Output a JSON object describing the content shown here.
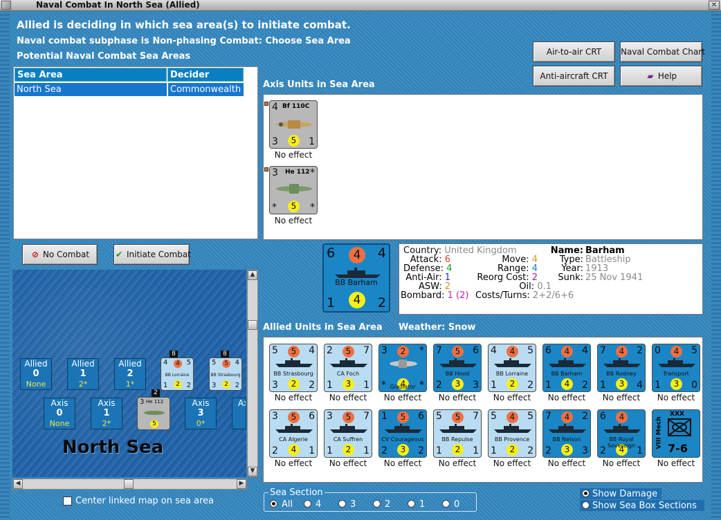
{
  "window": {
    "title": "Naval Combat In North Sea (Allied)"
  },
  "header": {
    "line1": "Allied is deciding in which sea area(s) to initiate combat.",
    "line2": "Naval combat subphase is Non-phasing Combat: Choose Sea Area",
    "line3": "Potential Naval Combat Sea Areas"
  },
  "sea_table": {
    "columns": [
      "Sea Area",
      "Decider"
    ],
    "rows": [
      [
        "North Sea",
        "Commonwealth"
      ]
    ]
  },
  "buttons": {
    "air_to_air": "Air-to-air CRT",
    "naval_chart": "Naval Combat Chart",
    "anti_aircraft": "Anti-aircraft CRT",
    "help": "Help",
    "no_combat": "No Combat",
    "initiate": "Initiate Combat"
  },
  "axis_section": {
    "title": "Axis Units in Sea Area",
    "units": [
      {
        "name": "Bf 110C",
        "tl": "4",
        "bl": "3",
        "br": "1",
        "mid": "5",
        "effect": "No effect"
      },
      {
        "name": "He 112",
        "tl": "3",
        "tr": "*",
        "bl": "*",
        "br": "*",
        "mid": "5",
        "effect": "No effect"
      }
    ]
  },
  "selected_unit": {
    "name": "BB Barham",
    "tl": "6",
    "attack": "4",
    "tr": "4",
    "bl": "1",
    "defense": "4",
    "br": "2"
  },
  "info": {
    "country_label": "Country:",
    "country": "United Kingdom",
    "attack_label": "Attack:",
    "attack": "6",
    "defense_label": "Defense:",
    "defense": "4",
    "antiair_label": "Anti-Air:",
    "antiair": "1",
    "asw_label": "ASW:",
    "asw": "2",
    "bombard_label": "Bombard:",
    "bombard": "1 (2)",
    "move_label": "Move:",
    "move": "4",
    "range_label": "Range:",
    "range": "4",
    "reorg_label": "Reorg Cost:",
    "reorg": "2",
    "oil_label": "Oil:",
    "oil": "0.1",
    "costs_label": "Costs/Turns:",
    "costs": "2+2/6+6",
    "name_label": "Name:",
    "name": "Barham",
    "type_label": "Type:",
    "type": "Battleship",
    "year_label": "Year:",
    "year": "1913",
    "sunk_label": "Sunk:",
    "sunk": "25 Nov 1941"
  },
  "allied_section": {
    "title": "Allied Units in Sea Area",
    "weather": "Weather:  Snow",
    "row1": [
      {
        "name": "BB Strasbourg",
        "style": "light",
        "tl": "5",
        "o": "5",
        "tr": "4",
        "bl": "3",
        "y": "2",
        "br": "2",
        "effect": "No effect"
      },
      {
        "name": "CA Foch",
        "style": "light",
        "tl": "2",
        "o": "5",
        "tr": "7",
        "bl": "1",
        "y": "3",
        "br": "1",
        "effect": "No effect"
      },
      {
        "name": "Gladiator",
        "style": "blue",
        "tl": "3",
        "o": "2",
        "tr": "*",
        "bl": "*",
        "y": "4",
        "br": "*",
        "effect": "No effect"
      },
      {
        "name": "BB Hood",
        "style": "blue",
        "tl": "7",
        "o": "5",
        "tr": "6",
        "bl": "2",
        "y": "3",
        "br": "3",
        "effect": "No effect"
      },
      {
        "name": "BB Lorraine",
        "style": "light",
        "tl": "4",
        "o": "4",
        "tr": "5",
        "bl": "1",
        "y": "2",
        "br": "2",
        "effect": "No effect"
      },
      {
        "name": "BB Barham",
        "style": "blue",
        "tl": "6",
        "o": "4",
        "tr": "4",
        "bl": "1",
        "y": "4",
        "br": "2",
        "effect": "No effect"
      },
      {
        "name": "BB Rodney",
        "style": "blue",
        "tl": "7",
        "o": "4",
        "tr": "2",
        "bl": "1",
        "y": "3",
        "br": "4",
        "effect": "No effect"
      },
      {
        "name": "Transport",
        "style": "blue",
        "tl": "0",
        "o": "4",
        "tr": "5",
        "bl": "1",
        "y": "3",
        "br": "0",
        "effect": "No effect"
      }
    ],
    "row2": [
      {
        "name": "CA Algerie",
        "style": "light",
        "tl": "3",
        "o": "5",
        "tr": "6",
        "bl": "2",
        "y": "4",
        "br": "1",
        "effect": "No effect"
      },
      {
        "name": "CA Suffren",
        "style": "light",
        "tl": "3",
        "o": "5",
        "tr": "7",
        "bl": "1",
        "y": "2",
        "br": "1",
        "effect": "No effect"
      },
      {
        "name": "CV Courageous",
        "style": "blue",
        "tl": "1",
        "o": "5",
        "tr": "6",
        "bl": "2",
        "y": "3",
        "br": "2",
        "effect": "No effect"
      },
      {
        "name": "BB Repulse",
        "style": "light",
        "tl": "5",
        "o": "5",
        "tr": "7",
        "bl": "1",
        "y": "2",
        "br": "1",
        "effect": "No effect"
      },
      {
        "name": "BB Provence",
        "style": "light",
        "tl": "5",
        "o": "4",
        "tr": "5",
        "bl": "1",
        "y": "2",
        "br": "2",
        "effect": "No effect"
      },
      {
        "name": "BB Nelson",
        "style": "blue",
        "tl": "7",
        "o": "4",
        "tr": "2",
        "bl": "2",
        "y": "3",
        "br": "3",
        "effect": "No effect"
      },
      {
        "name": "BB Royal Sovereign",
        "style": "blue",
        "tl": "6",
        "o": "4",
        "tr": "",
        "bl": "2",
        "y": "4",
        "br": "1",
        "effect": "No effect"
      },
      {
        "name": "VIII Mech",
        "style": "blue",
        "army": "7-6",
        "effect": "No effect"
      }
    ]
  },
  "map": {
    "sea_name": "North Sea",
    "allied_cells": [
      {
        "label": "Allied",
        "num": "0",
        "sub": "None"
      },
      {
        "label": "Allied",
        "num": "1",
        "sub": "2*"
      },
      {
        "label": "Allied",
        "num": "2",
        "sub": "1*"
      }
    ],
    "axis_cells": [
      {
        "label": "Axis",
        "num": "0",
        "sub": "None"
      },
      {
        "label": "Axis",
        "num": "1",
        "sub": "2*"
      },
      {
        "label": "Axis",
        "num": "3",
        "sub": "0*"
      },
      {
        "label": "Ax",
        "num": "",
        "sub": ""
      }
    ],
    "stack_counts": [
      "8",
      "8",
      "2"
    ],
    "mini_units": [
      {
        "name": "BB Lorraine",
        "tl": "4",
        "o": "4",
        "tr": "5",
        "bl": "1",
        "y": "2",
        "br": "2"
      },
      {
        "name": "BB Strasbourg",
        "tl": "5",
        "o": "5",
        "tr": "4",
        "bl": "3",
        "y": "2",
        "br": "2"
      },
      {
        "name": "He 112",
        "tl": "3",
        "y": "5"
      }
    ]
  },
  "checkbox": {
    "center_linked": "Center linked map on sea area"
  },
  "sea_section": {
    "legend": "Sea Section",
    "options": [
      "All",
      "4",
      "3",
      "2",
      "1",
      "0"
    ],
    "selected": "All"
  },
  "radios_right": {
    "show_damage": "Show Damage",
    "show_boxes": "Show Sea Box Sections"
  },
  "colors": {
    "counter_blue": "#1a86c6",
    "counter_light": "#b9dcf2",
    "attack_orange": "#ef7043",
    "defense_yellow": "#f7ee1a"
  }
}
